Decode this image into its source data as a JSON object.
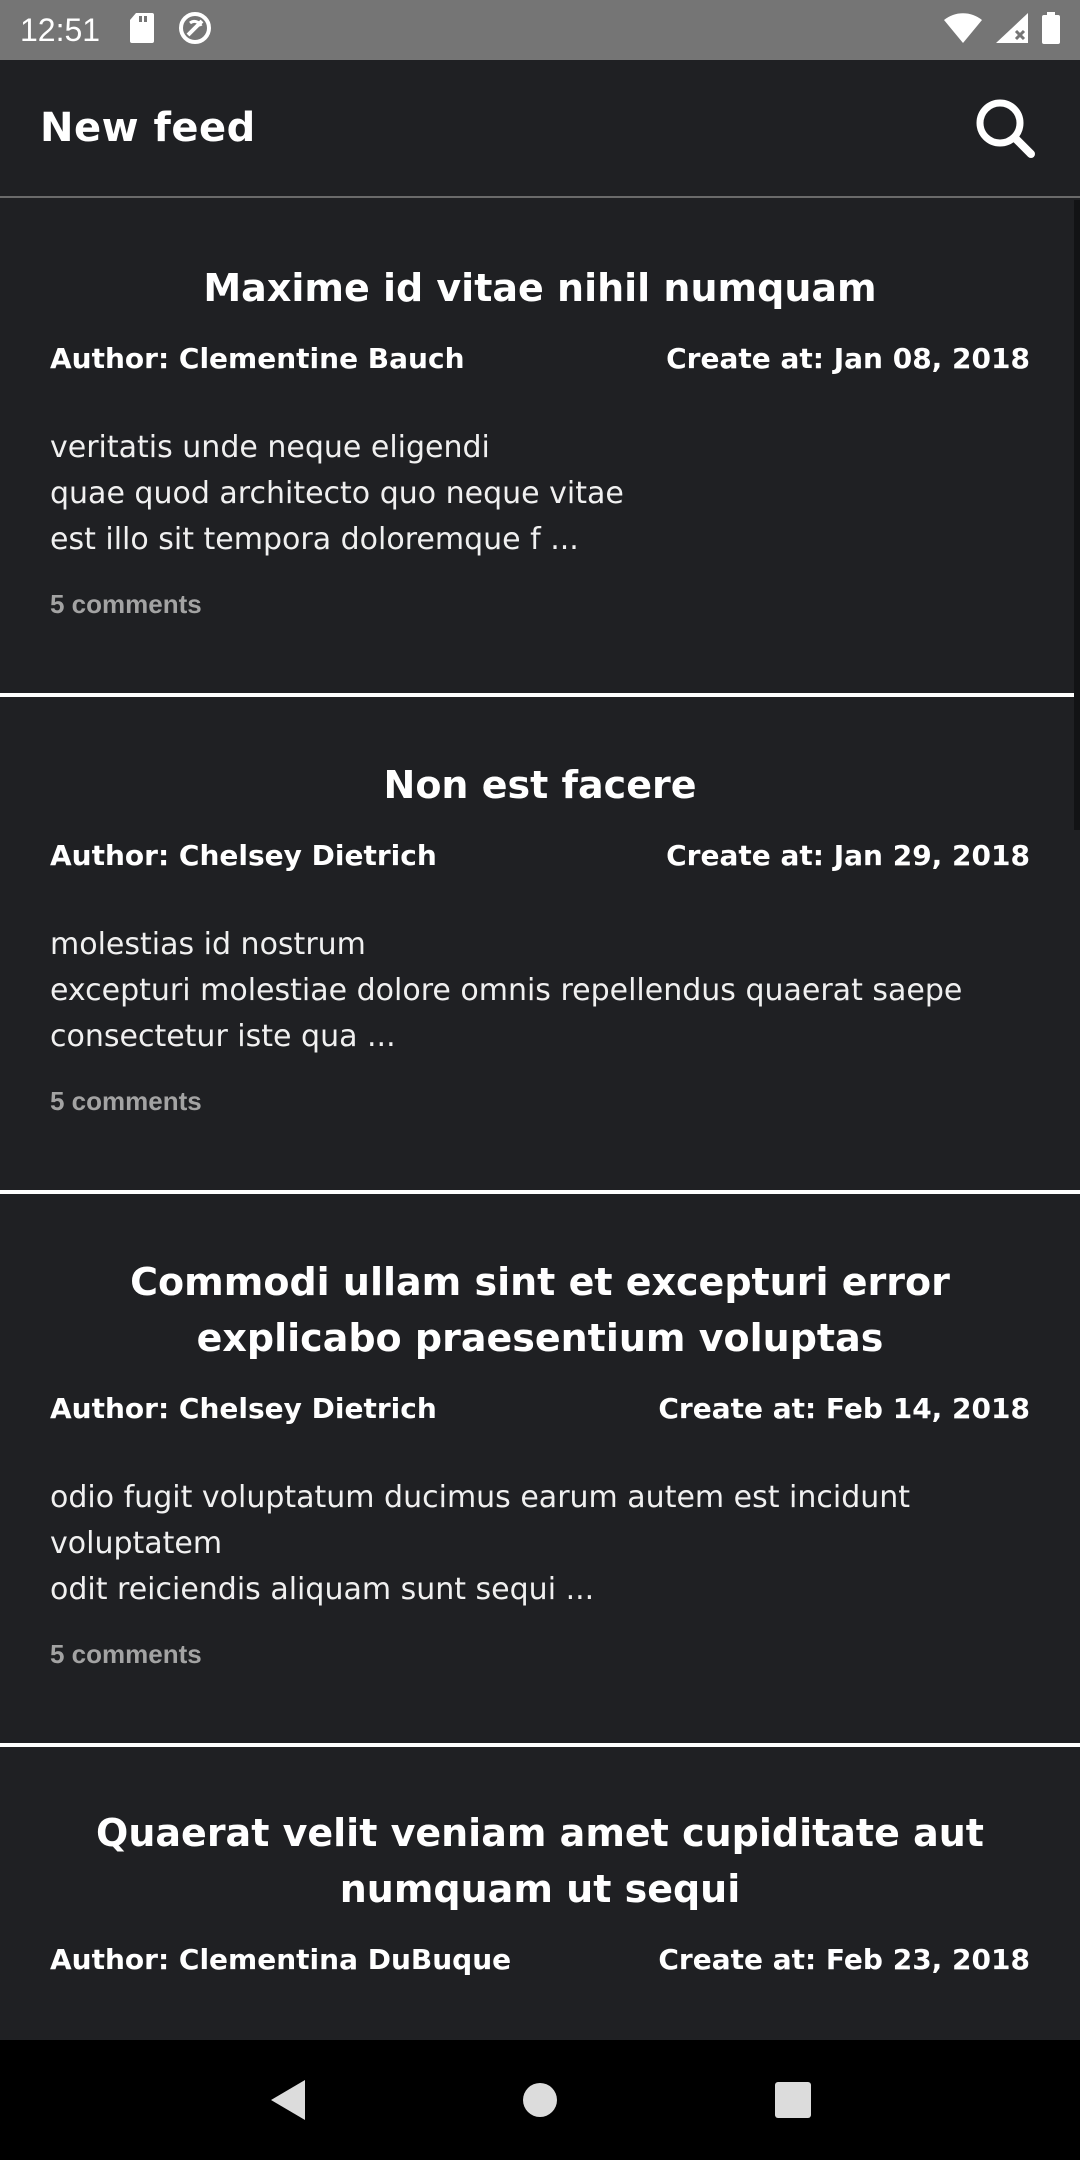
{
  "status_bar": {
    "time": "12:51",
    "left_icons": [
      "sd-card-icon",
      "sync-icon"
    ],
    "right_icons": [
      "wifi-icon",
      "signal-icon",
      "battery-icon"
    ]
  },
  "app_bar": {
    "title": "New feed",
    "search_icon": "search-icon"
  },
  "posts": [
    {
      "title": "Maxime id vitae nihil numquam",
      "author": "Author: Clementine Bauch",
      "created": "Create at: Jan 08, 2018",
      "body": [
        "veritatis unde neque eligendi",
        "quae quod architecto quo neque vitae",
        "est illo sit tempora doloremque f ..."
      ],
      "comments": "5 comments"
    },
    {
      "title": "Non est facere",
      "author": "Author: Chelsey Dietrich",
      "created": "Create at: Jan 29, 2018",
      "body": [
        "molestias id nostrum",
        "excepturi molestiae dolore omnis repellendus quaerat saepe",
        "consectetur iste qua ..."
      ],
      "comments": "5 comments"
    },
    {
      "title": "Commodi ullam sint et excepturi error explicabo praesentium voluptas",
      "author": "Author: Chelsey Dietrich",
      "created": "Create at: Feb 14, 2018",
      "body": [
        "odio fugit voluptatum ducimus earum autem est incidunt",
        "voluptatem",
        "odit reiciendis aliquam sunt sequi ..."
      ],
      "comments": "5 comments"
    },
    {
      "title": "Quaerat velit veniam amet cupiditate aut numquam ut sequi",
      "author": "Author: Clementina DuBuque",
      "created": "Create at: Feb 23, 2018"
    }
  ],
  "nav_bar": {
    "icons": [
      "back-icon",
      "home-icon",
      "recents-icon"
    ]
  }
}
